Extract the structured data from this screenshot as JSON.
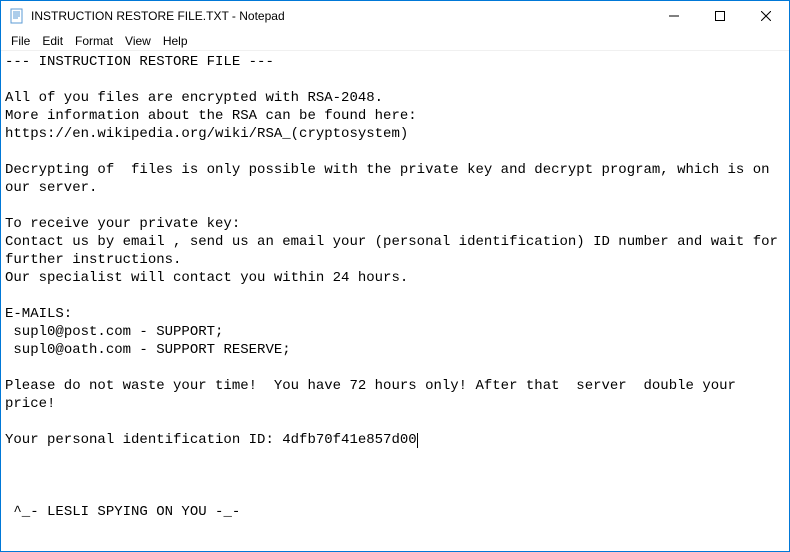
{
  "titlebar": {
    "title": "INSTRUCTION RESTORE FILE.TXT - Notepad"
  },
  "menubar": {
    "file": "File",
    "edit": "Edit",
    "format": "Format",
    "view": "View",
    "help": "Help"
  },
  "document": {
    "line1": "--- INSTRUCTION RESTORE FILE ---",
    "blank1": "",
    "line2": "All of you files are encrypted with RSA-2048.",
    "line3": "More information about the RSA can be found here:",
    "line4": "https://en.wikipedia.org/wiki/RSA_(cryptosystem)",
    "blank2": "",
    "line5": "Decrypting of  files is only possible with the private key and decrypt program, which is on our server.",
    "blank3": "",
    "line6": "To receive your private key:",
    "line7": "Contact us by email , send us an email your (personal identification) ID number and wait for further instructions.",
    "line8": "Our specialist will contact you within 24 hours.",
    "blank4": "",
    "line9": "E-MAILS:",
    "line10": " supl0@post.com - SUPPORT;",
    "line11": " supl0@oath.com - SUPPORT RESERVE;",
    "blank5": "",
    "line12": "Please do not waste your time!  You have 72 hours only! After that  server  double your price!",
    "blank6": "",
    "line13": "Your personal identification ID: 4dfb70f41e857d00",
    "blank7": "",
    "blank8": "",
    "blank9": "",
    "line14": " ^_- LESLI SPYING ON YOU -_-"
  }
}
